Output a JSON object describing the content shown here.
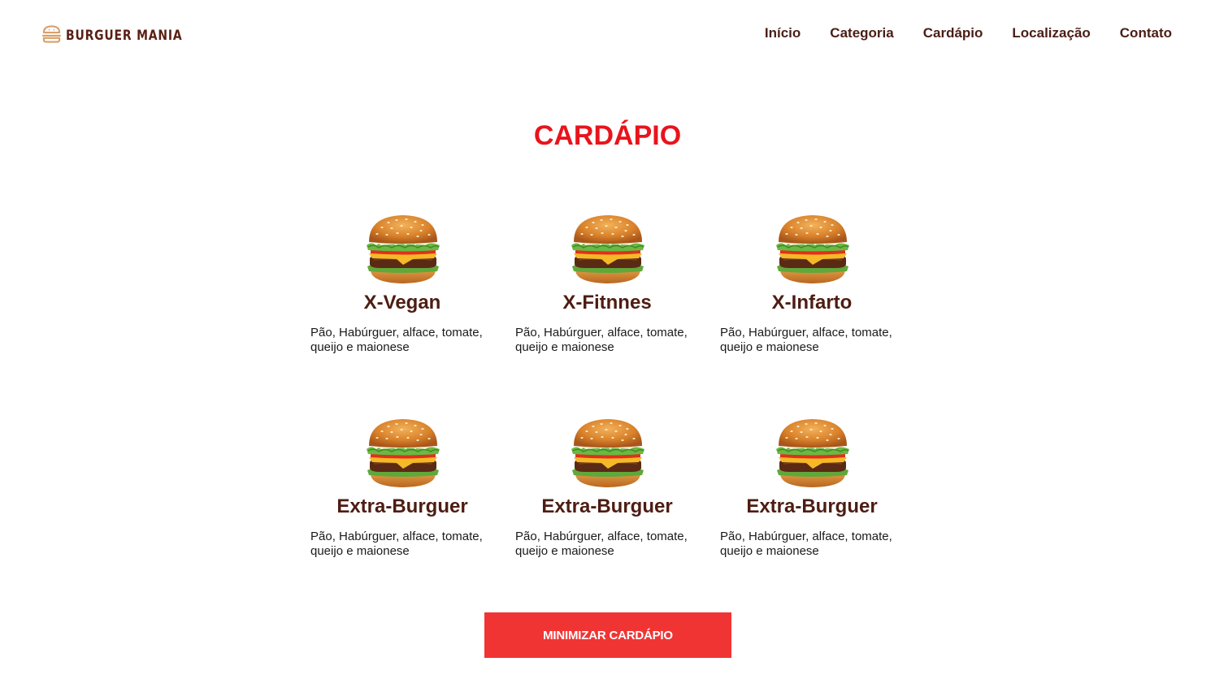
{
  "header": {
    "brand": "BURGUER MANIA",
    "brand_icon": "burger-icon",
    "nav": [
      {
        "label": "Início"
      },
      {
        "label": "Categoria"
      },
      {
        "label": "Cardápio"
      },
      {
        "label": "Localização"
      },
      {
        "label": "Contato"
      }
    ]
  },
  "menu": {
    "title": "CARDÁPIO",
    "items": [
      {
        "name": "X-Vegan",
        "description": "Pão, Habúrguer, alface, tomate, queijo e maionese",
        "image": "burger-image"
      },
      {
        "name": "X-Fitnnes",
        "description": "Pão, Habúrguer, alface, tomate, queijo e maionese",
        "image": "burger-image"
      },
      {
        "name": "X-Infarto",
        "description": "Pão, Habúrguer, alface, tomate, queijo e maionese",
        "image": "burger-image"
      },
      {
        "name": "Extra-Burguer",
        "description": "Pão, Habúrguer, alface, tomate, queijo e maionese",
        "image": "burger-image"
      },
      {
        "name": "Extra-Burguer",
        "description": "Pão, Habúrguer, alface, tomate, queijo e maionese",
        "image": "burger-image"
      },
      {
        "name": "Extra-Burguer",
        "description": "Pão, Habúrguer, alface, tomate, queijo e maionese",
        "image": "burger-image"
      }
    ],
    "button_label": "MINIMIZAR CARDÁPIO"
  },
  "colors": {
    "accent": "#e8141c",
    "button": "#f03434",
    "brand_text": "#5a1f14",
    "logo_icon": "#d9a06a"
  }
}
